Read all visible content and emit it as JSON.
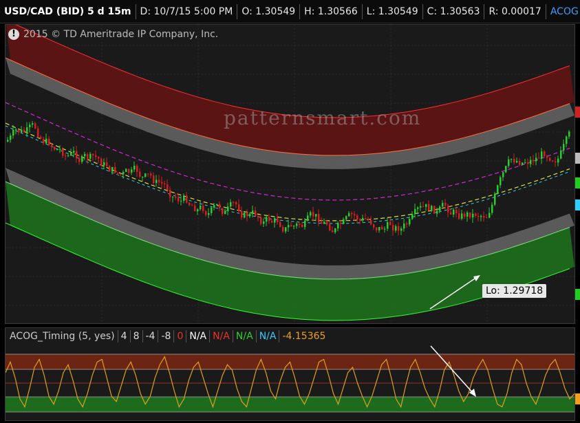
{
  "header": {
    "symbol": "USD/CAD (BID) 5 d 15m",
    "date": "D: 10/7/15 5:00 PM",
    "open": "O: 1.30549",
    "high": "H: 1.30566",
    "low": "L: 1.30549",
    "close": "C: 1.30563",
    "range": "R: 0.00017",
    "study": "ACOG ..."
  },
  "copyright": "2015 © TD Ameritrade IP Company, Inc.",
  "watermark": "patternsmart.com",
  "lo_label": "Lo: 1.29718",
  "lower": {
    "name": "ACOG_Timing (5, yes)",
    "params": [
      "4",
      "8",
      "-4",
      "-8"
    ],
    "zero": "0",
    "na_white": "N/A",
    "na_red": "N/A",
    "na_green": "N/A",
    "na_cyan": "N/A",
    "value": "-4.15365"
  },
  "colors": {
    "upper_band": "#5e1414",
    "lower_band": "#1e6b1e",
    "up_candle": "#2ecc2e",
    "down_candle": "#d62020",
    "magenta_line": "#d02ad0",
    "yellow_line": "#e0e040",
    "cyan_line": "#30d0e0",
    "osc_line": "#e0a020"
  },
  "chart_data": {
    "type": "line",
    "series": [
      {
        "values": [
          0.4,
          0.8,
          0.2,
          -0.6,
          -0.9,
          -0.2,
          0.6,
          0.9,
          0.3,
          -0.5,
          -0.8,
          -0.3,
          0.4,
          0.7,
          0.1,
          -0.6,
          -0.9,
          -0.4,
          0.3,
          0.8,
          0.9,
          0.2,
          -0.5,
          -0.7,
          -0.1,
          0.5,
          0.8,
          0.3,
          -0.4,
          -0.8,
          -0.5,
          0.2,
          0.7,
          1.0,
          0.4,
          -0.3,
          -0.9,
          -0.6,
          0.1,
          0.6,
          0.8,
          0.2,
          -0.4,
          -0.9,
          -0.3,
          0.3,
          0.7,
          0.5,
          -0.2,
          -0.7,
          -0.9,
          -0.2,
          0.5,
          0.9,
          0.4,
          -0.3,
          -0.6,
          0.1,
          0.6,
          0.8,
          0.2,
          -0.5,
          -0.8,
          -0.4,
          0.2,
          0.8,
          0.9,
          0.3,
          -0.4,
          -0.8,
          -0.2,
          0.4,
          0.6,
          0.0,
          -0.5,
          -0.9,
          -0.5,
          0.1,
          0.7,
          0.9,
          0.2,
          -0.6,
          -0.9,
          -0.1,
          0.6,
          0.9,
          0.4,
          -0.2,
          -0.6,
          -0.9,
          -0.3,
          0.5,
          0.8,
          0.3,
          -0.3,
          -0.7,
          -0.4,
          0.2,
          0.6,
          0.9,
          0.5,
          -0.2,
          -0.8,
          -0.9,
          -0.4,
          0.4,
          0.9,
          0.7,
          0.0,
          -0.5,
          -0.8,
          -0.3,
          0.3,
          0.7,
          0.9,
          0.4,
          -0.2,
          -0.6,
          -0.4
        ]
      }
    ],
    "ylim": [
      -1.2,
      1.2
    ],
    "marked_low": 1.29718
  }
}
